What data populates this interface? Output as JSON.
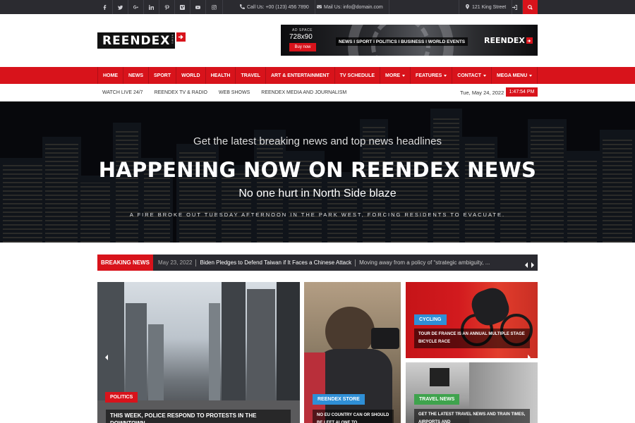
{
  "topbar": {
    "social": [
      "facebook-icon",
      "twitter-icon",
      "google-plus-icon",
      "linkedin-icon",
      "pinterest-icon",
      "vimeo-icon",
      "youtube-icon",
      "instagram-icon"
    ],
    "phone": "Call Us: +00 (123) 456 7890",
    "email": "Mail Us: info@domain.com",
    "address": "121 King Street"
  },
  "header": {
    "logo_text": "REENDEX",
    "logo_sub": "NEWS",
    "ad": {
      "label": "AD SPACE",
      "size": "728x90",
      "button": "Buy now",
      "categories": "NEWS I SPORT I POLITICS I BUSINESS I WORLD EVENTS",
      "logo": "REENDEX"
    }
  },
  "nav": {
    "items": [
      {
        "label": "HOME",
        "dropdown": false
      },
      {
        "label": "NEWS",
        "dropdown": false
      },
      {
        "label": "SPORT",
        "dropdown": false
      },
      {
        "label": "WORLD",
        "dropdown": false
      },
      {
        "label": "HEALTH",
        "dropdown": false
      },
      {
        "label": "TRAVEL",
        "dropdown": false
      },
      {
        "label": "ART & ENTERTAINMENT",
        "dropdown": false
      },
      {
        "label": "TV SCHEDULE",
        "dropdown": false
      },
      {
        "label": "MORE",
        "dropdown": true
      },
      {
        "label": "FEATURES",
        "dropdown": true
      },
      {
        "label": "CONTACT",
        "dropdown": true
      },
      {
        "label": "MEGA MENU",
        "dropdown": true
      }
    ]
  },
  "subnav": {
    "items": [
      "WATCH LIVE 24/7",
      "REENDEX TV & RADIO",
      "WEB SHOWS",
      "REENDEX MEDIA AND JOURNALISM"
    ],
    "date": "Tue, May 24, 2022",
    "time": "1:47:54 PM"
  },
  "hero": {
    "top": "Get the latest breaking news and top news headlines",
    "title": "HAPPENING NOW ON REENDEX NEWS",
    "subtitle": "No one hurt in North Side blaze",
    "description": "A FIRE BROKE OUT TUESDAY AFTERNOON IN THE PARK WEST, FORCING RESIDENTS TO EVACUATE."
  },
  "breaking": {
    "label": "BREAKING NEWS",
    "date": "May 23, 2022",
    "title": "Biden Pledges to Defend Taiwan if It Faces a Chinese Attack",
    "excerpt": "Moving away from a policy of “strategic ambiguity, ..."
  },
  "cards": [
    {
      "tag": "POLITICS",
      "caption": "THIS WEEK, POLICE RESPOND TO PROTESTS IN THE DOWNTOWN",
      "tag_color": "#d8131b"
    },
    {
      "tag": "REENDEX STORE",
      "caption": "NO EU COUNTRY CAN OR SHOULD BE LEFT ALONE TO",
      "tag_color": "#2f8fd6"
    },
    {
      "tag": "CYCLING",
      "caption": "TOUR DE FRANCE IS AN ANNUAL MULTIPLE STAGE BICYCLE RACE",
      "tag_color": "#2f8fd6"
    },
    {
      "tag": "TRAVEL NEWS",
      "caption": "GET THE LATEST TRAVEL NEWS AND TRAIN TIMES, AIRPORTS AND",
      "tag_color": "#3fa34d"
    }
  ]
}
